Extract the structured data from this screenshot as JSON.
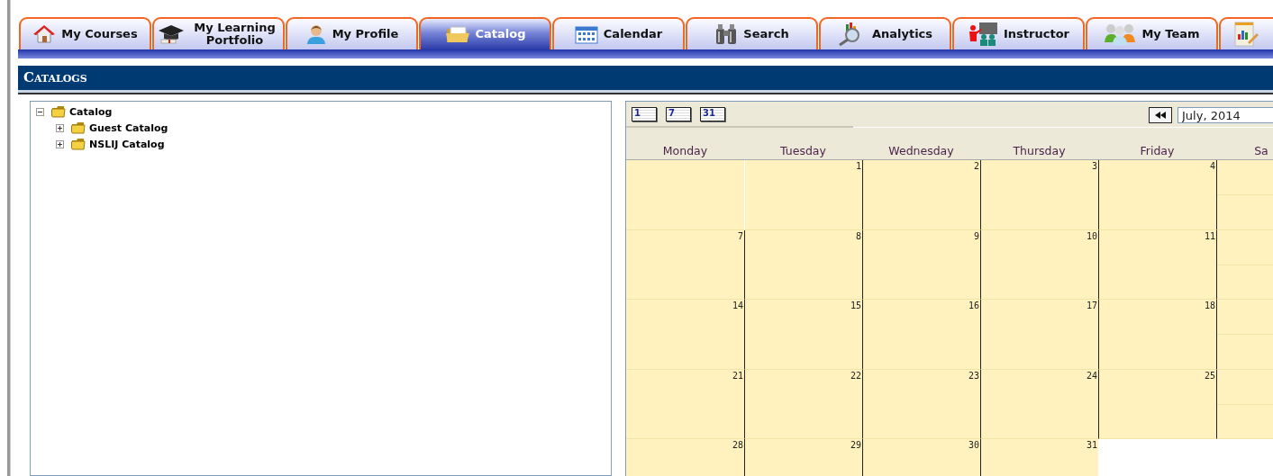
{
  "tabs": [
    {
      "label": "My Courses",
      "selected": false
    },
    {
      "label": "My Learning Portfolio",
      "selected": false
    },
    {
      "label": "My Profile",
      "selected": false
    },
    {
      "label": "Catalog",
      "selected": true
    },
    {
      "label": "Calendar",
      "selected": false
    },
    {
      "label": "Search",
      "selected": false
    },
    {
      "label": "Analytics",
      "selected": false
    },
    {
      "label": "Instructor",
      "selected": false
    },
    {
      "label": "My Team",
      "selected": false
    },
    {
      "selected": false
    }
  ],
  "section_title": "Catalogs",
  "tree": [
    {
      "label": "Catalog",
      "expanded": true,
      "children": [
        {
          "label": "Guest Catalog",
          "expanded": false
        },
        {
          "label": "NSLIJ Catalog",
          "expanded": false
        }
      ]
    }
  ],
  "calendar": {
    "view_buttons": [
      "1",
      "7",
      "31"
    ],
    "month": "July, 2014",
    "day_names": [
      "Monday",
      "Tuesday",
      "Wednesday",
      "Thursday",
      "Friday",
      "Sa"
    ],
    "weeks": [
      [
        {
          "kind": "empty"
        },
        {
          "kind": "day",
          "date": "1"
        },
        {
          "kind": "day",
          "date": "2"
        },
        {
          "kind": "day",
          "date": "3"
        },
        {
          "kind": "day",
          "date": "4"
        },
        {
          "kind": "empty"
        }
      ],
      [
        {
          "kind": "day",
          "date": "7"
        },
        {
          "kind": "day",
          "date": "8"
        },
        {
          "kind": "day",
          "date": "9"
        },
        {
          "kind": "day",
          "date": "10"
        },
        {
          "kind": "day",
          "date": "11"
        },
        {
          "kind": "empty"
        }
      ],
      [
        {
          "kind": "day",
          "date": "14"
        },
        {
          "kind": "day",
          "date": "15"
        },
        {
          "kind": "day",
          "date": "16"
        },
        {
          "kind": "day",
          "date": "17"
        },
        {
          "kind": "day",
          "date": "18"
        },
        {
          "kind": "empty"
        }
      ],
      [
        {
          "kind": "day",
          "date": "21"
        },
        {
          "kind": "day",
          "date": "22"
        },
        {
          "kind": "day",
          "date": "23"
        },
        {
          "kind": "day",
          "date": "24"
        },
        {
          "kind": "day",
          "date": "25"
        },
        {
          "kind": "empty"
        }
      ],
      [
        {
          "kind": "day",
          "date": "28"
        },
        {
          "kind": "day",
          "date": "29"
        },
        {
          "kind": "day",
          "date": "30"
        },
        {
          "kind": "day",
          "date": "31"
        },
        {
          "kind": "outside"
        },
        {
          "kind": "outside"
        }
      ]
    ]
  }
}
